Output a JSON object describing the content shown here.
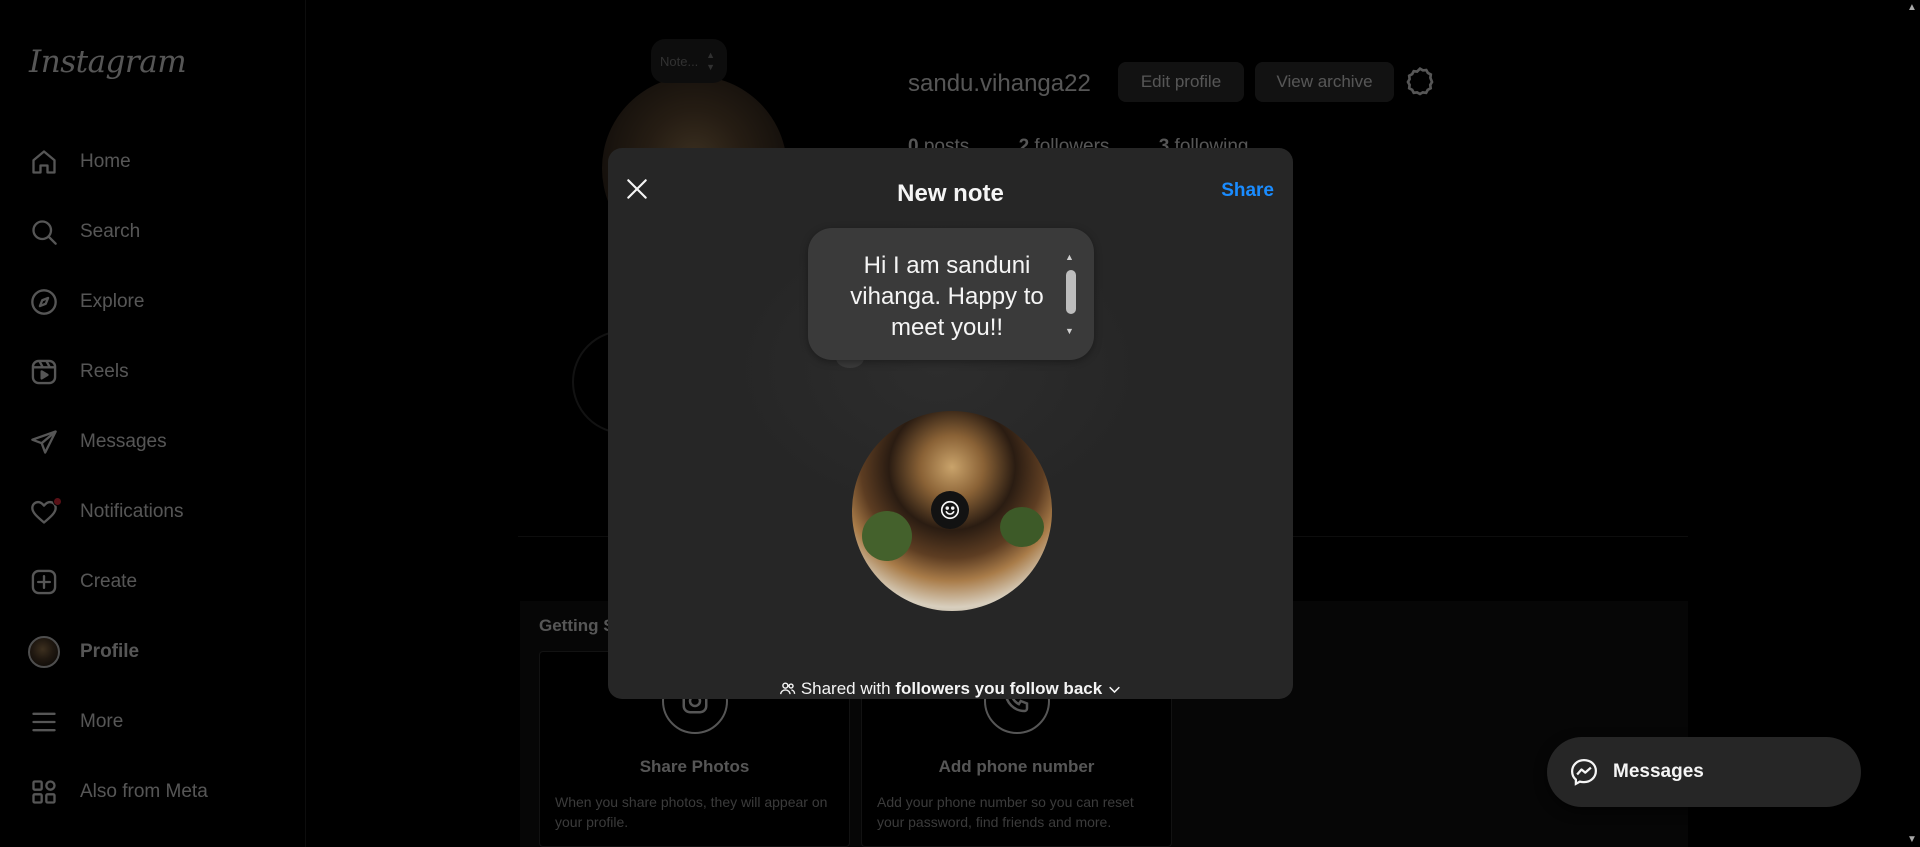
{
  "sidebar": {
    "logo": "Instagram",
    "items": [
      {
        "label": "Home",
        "icon": "home-icon"
      },
      {
        "label": "Search",
        "icon": "search-icon"
      },
      {
        "label": "Explore",
        "icon": "compass-icon"
      },
      {
        "label": "Reels",
        "icon": "reels-icon"
      },
      {
        "label": "Messages",
        "icon": "send-icon"
      },
      {
        "label": "Notifications",
        "icon": "heart-icon"
      },
      {
        "label": "Create",
        "icon": "plus-square-icon"
      },
      {
        "label": "Profile",
        "icon": "avatar"
      },
      {
        "label": "More",
        "icon": "menu-icon"
      },
      {
        "label": "Also from Meta",
        "icon": "grid-icon"
      }
    ]
  },
  "profile": {
    "note_placeholder": "Note...",
    "username": "sandu.vihanga22",
    "edit_profile": "Edit profile",
    "view_archive": "View archive",
    "stats": {
      "posts_count": "0",
      "posts_label": "posts",
      "followers_count": "2",
      "followers_label": "followers",
      "following_count": "3",
      "following_label": "following"
    },
    "getting_started": "Getting Started",
    "cards": [
      {
        "title": "Share Photos",
        "desc": "When you share photos, they will appear on your profile."
      },
      {
        "title": "Add phone number",
        "desc": "Add your phone number so you can reset your password, find friends and more."
      }
    ]
  },
  "modal": {
    "title": "New note",
    "share": "Share",
    "note_text": "Hi I am sanduni vihanga. Happy to meet you!!",
    "shared_prefix": "Shared with ",
    "shared_audience": "followers you follow back"
  },
  "messages_pill": "Messages",
  "colors": {
    "background": "#000000",
    "modal": "#262626",
    "accent": "#1a8cff",
    "notification_dot": "#ff3040"
  }
}
